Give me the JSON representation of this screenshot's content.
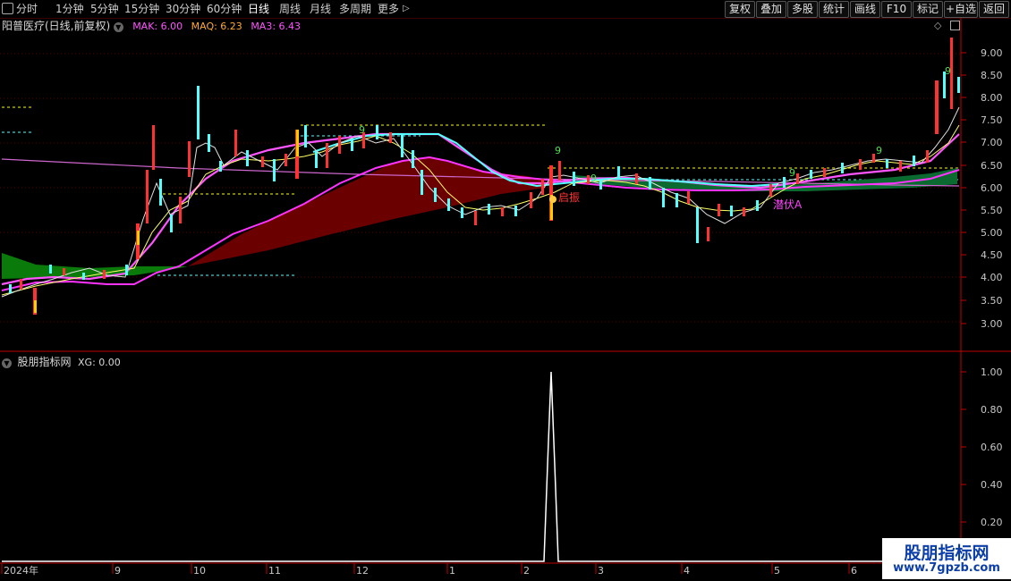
{
  "toolbar": {
    "periods": [
      "分时",
      "1分钟",
      "5分钟",
      "15分钟",
      "30分钟",
      "60分钟",
      "日线",
      "周线",
      "月线",
      "多周期",
      "更多"
    ],
    "active_period": "日线",
    "buttons": [
      "复权",
      "叠加",
      "多股",
      "统计",
      "画线",
      "F10",
      "标记",
      "+自选",
      "返回"
    ]
  },
  "main_panel": {
    "title": "阳普医疗(日线,前复权)",
    "ma_items": [
      {
        "label": "MAK: 6.00",
        "color": "#ff55ff"
      },
      {
        "label": "MAQ: 6.23",
        "color": "#ffaa33"
      },
      {
        "label": "MA3: 6.43",
        "color": "#ff55ff"
      }
    ],
    "y_ticks": [
      "9.00",
      "8.50",
      "8.00",
      "7.50",
      "7.00",
      "6.50",
      "6.00",
      "5.50",
      "5.00",
      "4.50",
      "4.00",
      "3.50",
      "3.00"
    ],
    "annotations": {
      "nine_labels": [
        "9",
        "9",
        "9",
        "9",
        "9",
        "9"
      ],
      "start_label": "启振",
      "ambush_label": "潜伏A"
    }
  },
  "sub_panel": {
    "title": "股朋指标网",
    "indicator": "XG: 0.00",
    "y_ticks": [
      "1.00",
      "0.80",
      "0.60",
      "0.40",
      "0.20"
    ]
  },
  "time_axis": [
    "2024年",
    "9",
    "10",
    "11",
    "12",
    "1",
    "2",
    "3",
    "4",
    "5",
    "6"
  ],
  "watermark": {
    "line1": "股朋指标网",
    "line2": "www.7gpzb.com"
  },
  "colors": {
    "up": "#ff3232",
    "down": "#54ffff",
    "yellow": "#ffff00",
    "magenta": "#ff55ff",
    "cyan": "#54ffff",
    "axis": "#c00000"
  }
}
